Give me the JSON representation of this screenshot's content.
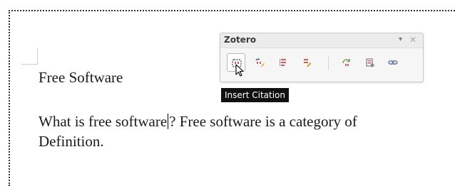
{
  "document": {
    "heading": "Free Software",
    "line1_before_cursor": "What is free software",
    "line1_after_cursor": "? Free software is a category of",
    "line2": "Definition."
  },
  "zotero": {
    "title": "Zotero",
    "menu_icon": "dropdown-arrow",
    "close_icon": "close-x",
    "menu_glyph": "▾",
    "close_glyph": "✕",
    "buttons": [
      {
        "icon": "insert-citation-icon"
      },
      {
        "icon": "edit-citation-icon"
      },
      {
        "icon": "insert-bibliography-icon"
      },
      {
        "icon": "edit-bibliography-icon"
      },
      {
        "icon": "refresh-icon"
      },
      {
        "icon": "document-preferences-icon"
      },
      {
        "icon": "unlink-citations-icon"
      }
    ],
    "tooltip": "Insert Citation"
  },
  "colors": {
    "icon_red": "#d85a5a",
    "icon_gold": "#d9a430",
    "tooltip_bg": "#111111"
  }
}
